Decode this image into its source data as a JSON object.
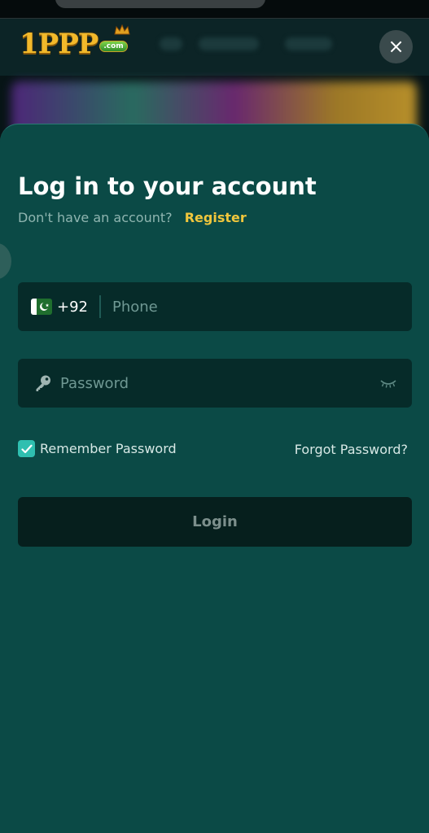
{
  "header": {
    "logo_text": "1PPP",
    "logo_badge": ".com",
    "close_label": "×"
  },
  "login": {
    "title": "Log in to your account",
    "no_account_text": "Don't have an account?",
    "register_label": "Register",
    "country_code": "+92",
    "phone_placeholder": "Phone",
    "password_placeholder": "Password",
    "remember_label": "Remember Password",
    "remember_checked": true,
    "forgot_label": "Forgot Password?",
    "login_label": "Login"
  },
  "icons": {
    "flag": "pakistan-flag-icon",
    "key": "key-icon",
    "eye": "eye-closed-icon",
    "check": "checkmark-icon",
    "close": "close-icon"
  },
  "colors": {
    "sheet_background": "#0b4a46",
    "field_background": "#062b29",
    "accent_register": "#f0c63c",
    "checkbox": "#2fbfb0",
    "login_button": "#061f1d"
  }
}
